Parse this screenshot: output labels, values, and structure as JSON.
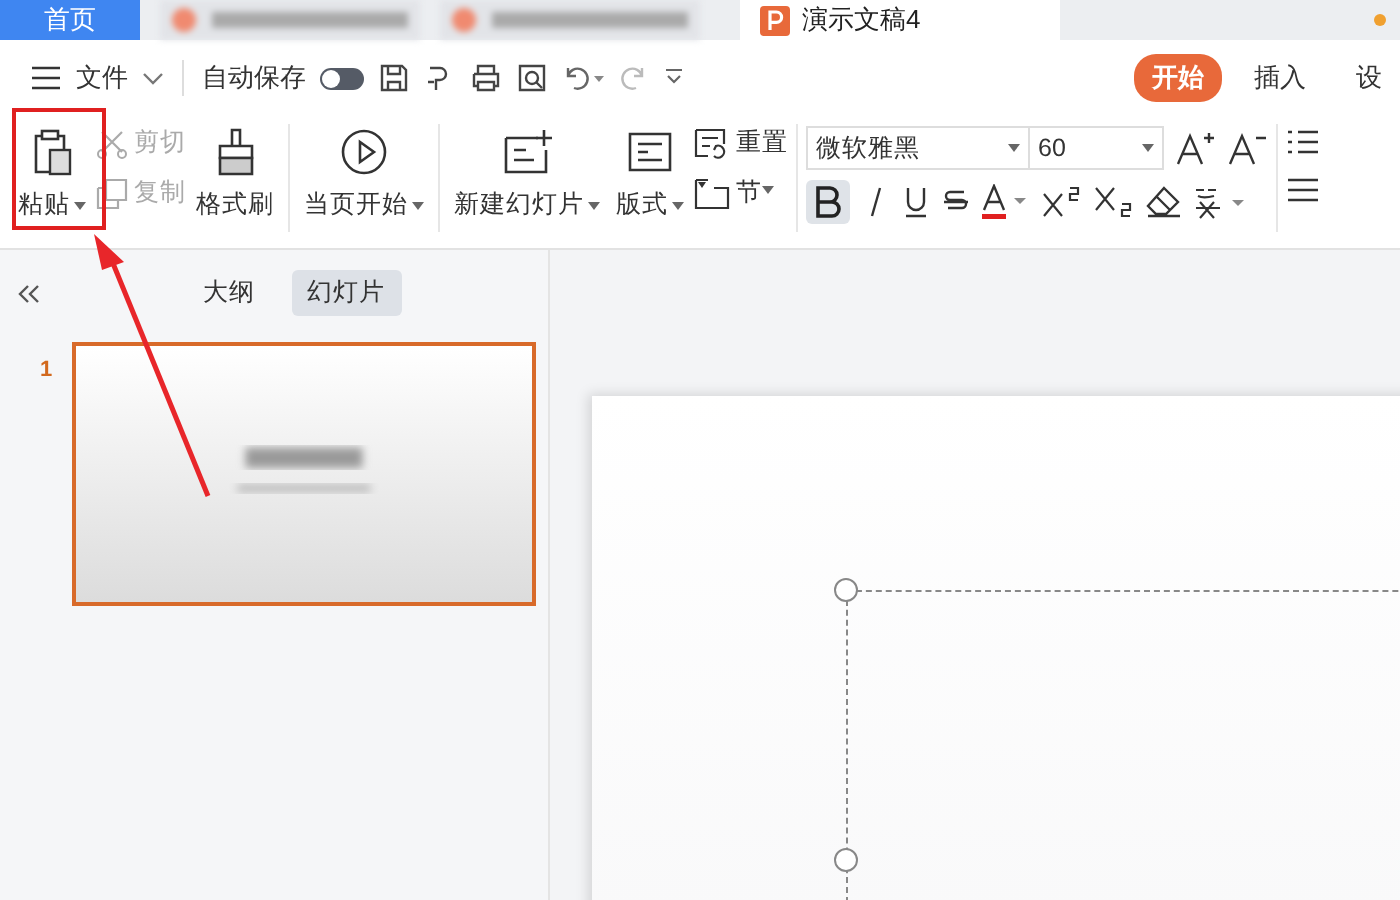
{
  "doc_tabs": [
    {
      "kind": "home",
      "label": "首页",
      "selected": false
    },
    {
      "kind": "blurred",
      "selected": false
    },
    {
      "kind": "blurred",
      "selected": false
    },
    {
      "kind": "doc",
      "label": "演示文稿4",
      "selected": true
    }
  ],
  "toolbar": {
    "menu_label": "文件",
    "autosave_label": "自动保存",
    "autosave_on": false
  },
  "menu_tabs": [
    {
      "label": "开始",
      "selected": true
    },
    {
      "label": "插入",
      "selected": false
    },
    {
      "label": "设",
      "selected": false
    }
  ],
  "clipboard": {
    "paste": "粘贴",
    "cut": {
      "label": "剪切",
      "disabled": true
    },
    "copy": {
      "label": "复制",
      "disabled": true
    },
    "format_painter": "格式刷"
  },
  "slide_group": {
    "play": "当页开始",
    "new_slide": "新建幻灯片",
    "layout": "版式",
    "reset": "重置",
    "section": "节"
  },
  "font": {
    "name": "微软雅黑",
    "size": "60",
    "bold": true
  },
  "pane_tabs": [
    {
      "label": "大纲",
      "selected": false
    },
    {
      "label": "幻灯片",
      "selected": true
    }
  ],
  "slides": [
    {
      "number": "1",
      "selected": true
    }
  ]
}
